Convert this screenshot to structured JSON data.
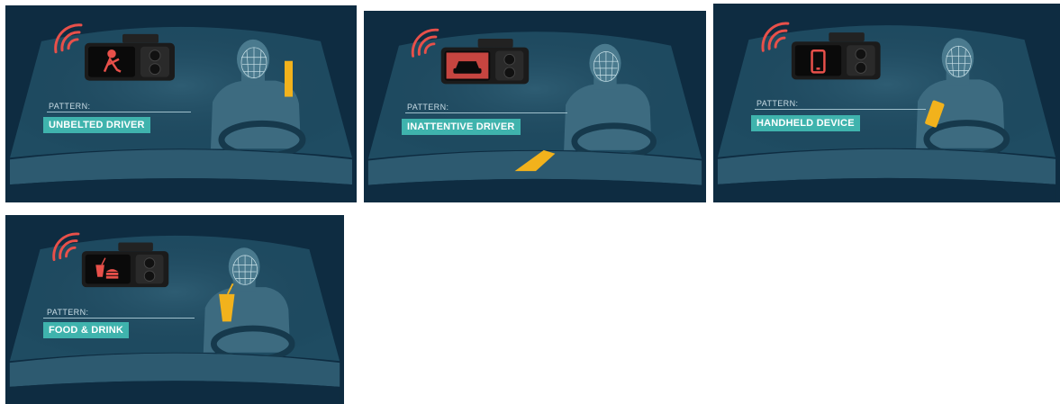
{
  "caption_label": "PATTERN:",
  "panels": [
    {
      "badge": "UNBELTED DRIVER",
      "icon": "seatbelt-icon",
      "highlight": "seatbelt-buckle"
    },
    {
      "badge": "INATTENTIVE DRIVER",
      "icon": "car-icon",
      "highlight": "reaching-hand"
    },
    {
      "badge": "HANDHELD DEVICE",
      "icon": "phone-icon",
      "highlight": "handheld-phone"
    },
    {
      "badge": "FOOD & DRINK",
      "icon": "food-drink-icon",
      "highlight": "drink-cup"
    }
  ],
  "colors": {
    "background": "#0e2c41",
    "badge": "#3fb3ad",
    "alert": "#e8504a",
    "highlight": "#f2b21c"
  }
}
